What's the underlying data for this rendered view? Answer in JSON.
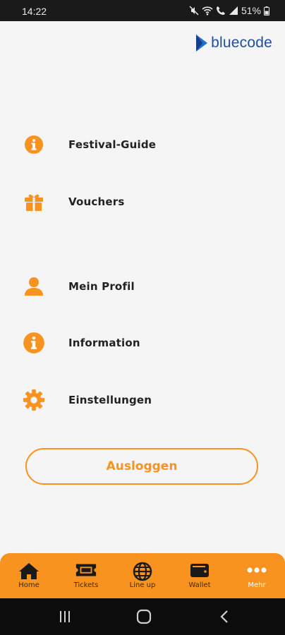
{
  "status_bar": {
    "time": "14:22",
    "battery": "51%"
  },
  "brand": {
    "name": "bluecode",
    "color": "#1f4f9e"
  },
  "accent_color": "#f7931e",
  "menu": {
    "items": [
      {
        "label": "Festival-Guide",
        "icon": "info-circle-icon"
      },
      {
        "label": "Vouchers",
        "icon": "gift-icon"
      },
      {
        "label": "Mein Profil",
        "icon": "person-icon"
      },
      {
        "label": "Information",
        "icon": "info-circle-icon"
      },
      {
        "label": "Einstellungen",
        "icon": "gear-icon"
      }
    ]
  },
  "logout": {
    "label": "Ausloggen"
  },
  "tabbar": {
    "tabs": [
      {
        "label": "Home",
        "icon": "home-icon"
      },
      {
        "label": "Tickets",
        "icon": "ticket-icon"
      },
      {
        "label": "Line up",
        "icon": "globe-icon"
      },
      {
        "label": "Wallet",
        "icon": "wallet-icon"
      },
      {
        "label": "Mehr",
        "icon": "more-dots-icon",
        "active": true
      }
    ]
  }
}
